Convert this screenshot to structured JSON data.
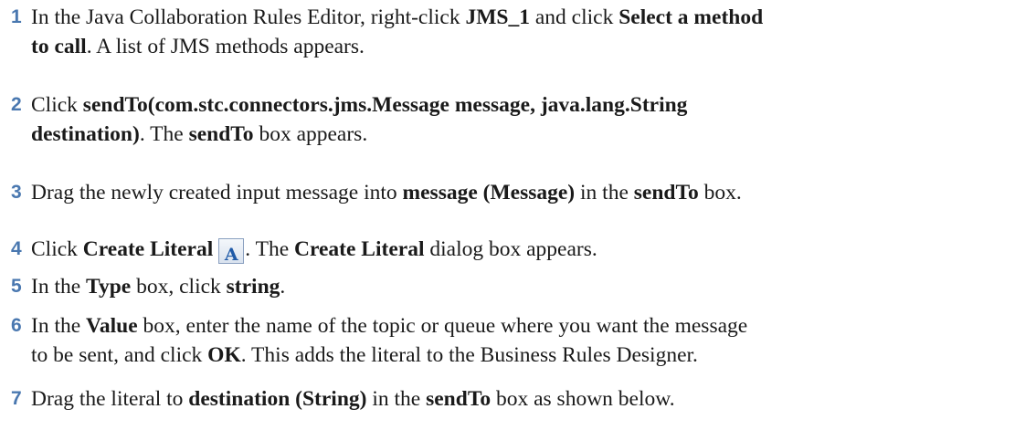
{
  "steps": [
    {
      "num": "1",
      "parts": [
        "In the Java Collaboration Rules Editor, right-click ",
        "JMS_1",
        " and click ",
        "Select a method",
        "to call",
        ". A list of JMS methods appears."
      ]
    },
    {
      "num": "2",
      "parts": [
        "Click ",
        "sendTo(com.stc.connectors.jms.Message message, java.lang.String",
        "destination)",
        ". The ",
        "sendTo",
        " box appears."
      ]
    },
    {
      "num": "3",
      "parts": [
        "Drag the newly created input message into ",
        "message (Message)",
        " in the ",
        "sendTo",
        " box."
      ]
    },
    {
      "num": "4",
      "parts": [
        "Click ",
        "Create Literal",
        ". The ",
        "Create Literal",
        " dialog box appears."
      ],
      "icon": {
        "name": "create-literal-icon",
        "glyph": "A"
      }
    },
    {
      "num": "5",
      "parts": [
        "In the ",
        "Type",
        " box, click ",
        "string",
        "."
      ]
    },
    {
      "num": "6",
      "parts": [
        "In the ",
        "Value",
        " box, enter the name of the topic or queue where you want the message",
        "to be sent, and click ",
        "OK",
        ". This adds the literal to the Business Rules Designer."
      ]
    },
    {
      "num": "7",
      "parts": [
        "Drag the literal to ",
        "destination (String)",
        " in the ",
        "sendTo",
        " box as shown below."
      ]
    }
  ]
}
